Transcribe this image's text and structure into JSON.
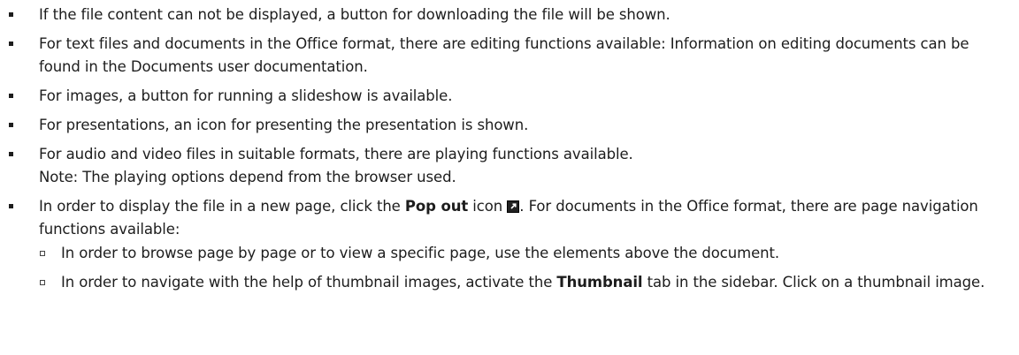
{
  "items": [
    {
      "text": "If the file content can not be displayed, a button for downloading the file will be shown."
    },
    {
      "text": "For text files and documents in the Office format, there are editing functions available: Information on editing documents can be found in the Documents user documentation."
    },
    {
      "text": "For images, a button for running a slideshow is available."
    },
    {
      "text": "For presentations, an icon for presenting the presentation is shown."
    },
    {
      "line1": "For audio and video files in suitable formats, there are playing functions available.",
      "line2": "Note: The playing options depend from the browser used."
    },
    {
      "pre": "In order to display the file in a new page, click the ",
      "bold": "Pop out",
      "mid": " icon",
      "icon": "pop-out-icon",
      "post": ". For documents in the Office format, there are page navigation functions available:",
      "subitems": [
        {
          "text": "In order to browse page by page or to view a specific page, use the elements above the document."
        },
        {
          "pre": "In order to navigate with the help of thumbnail images, activate the ",
          "bold": "Thumbnail",
          "post": " tab in the sidebar. Click on a thumbnail image."
        }
      ]
    }
  ]
}
